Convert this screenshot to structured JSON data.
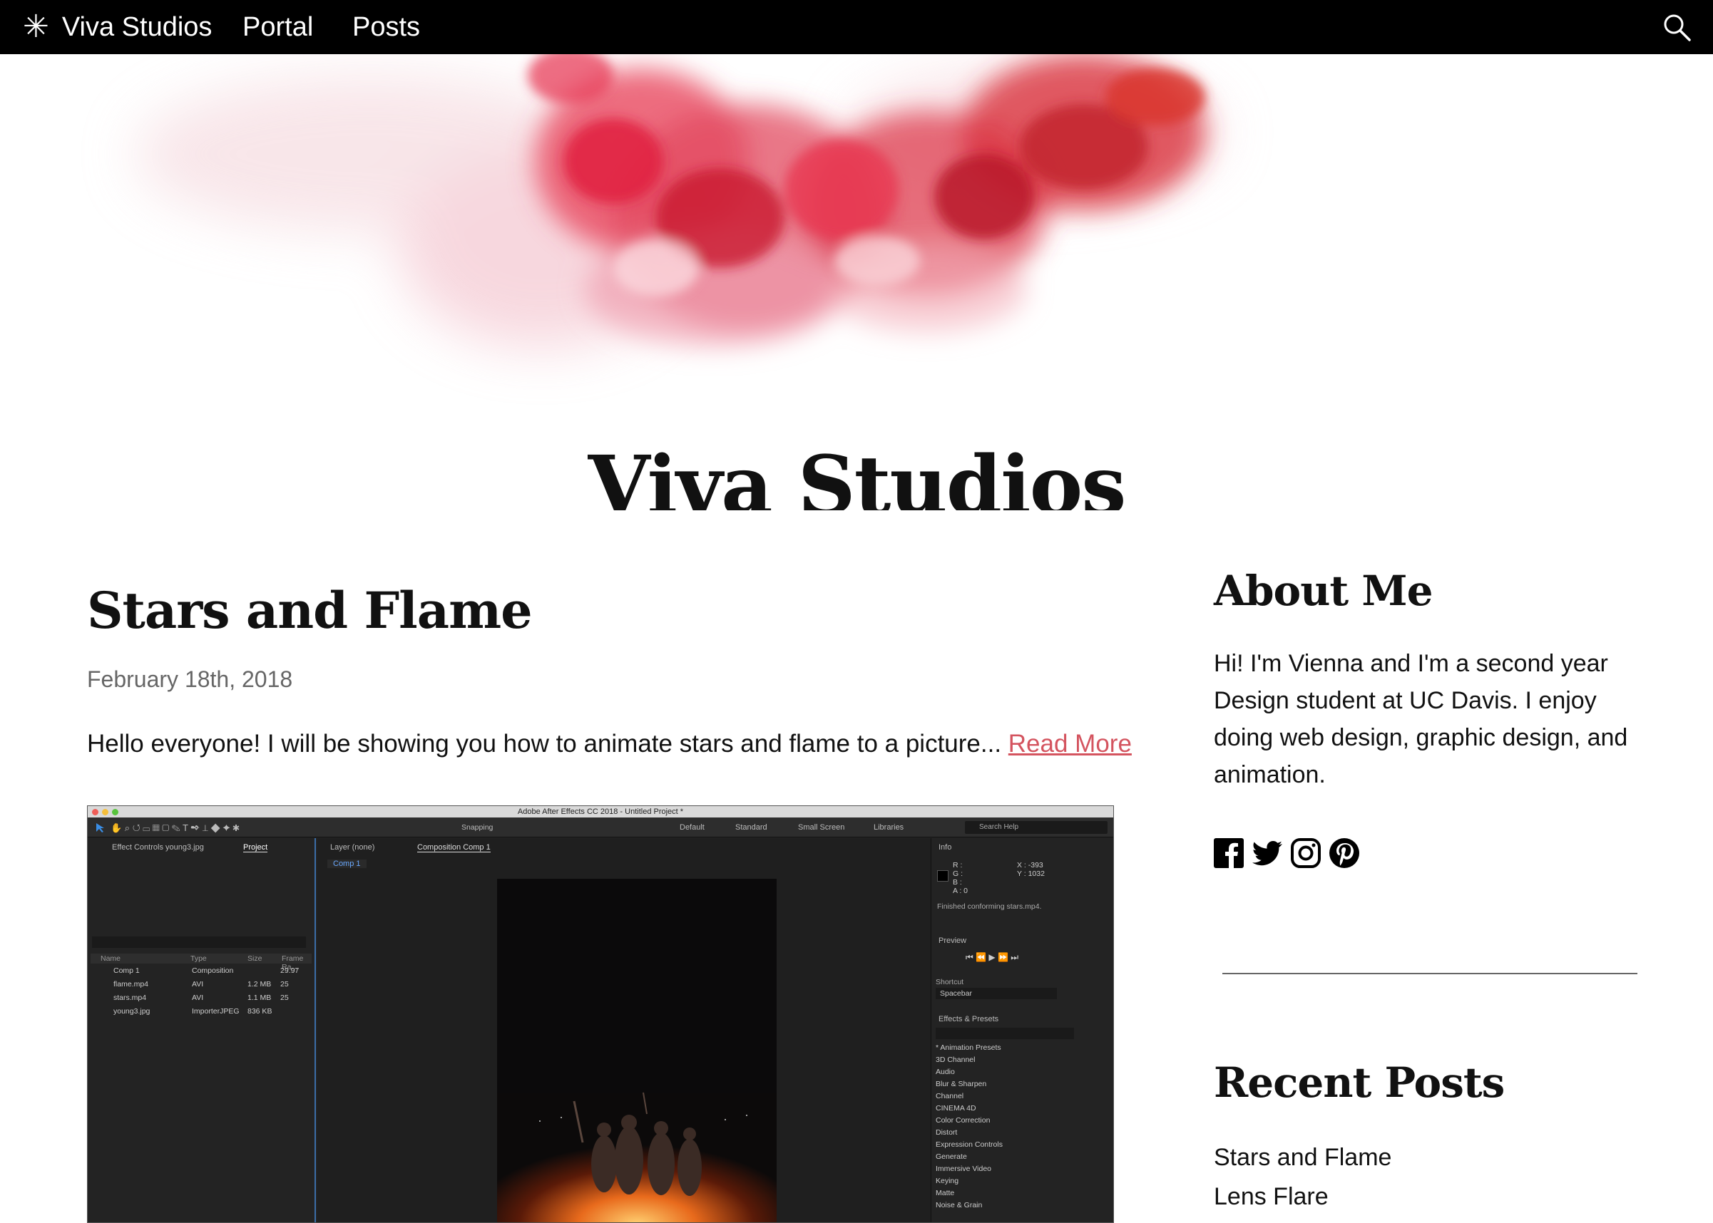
{
  "nav": {
    "brand": "Viva Studios",
    "links": [
      "Portal",
      "Posts"
    ]
  },
  "hero": {
    "title": "Viva Studios"
  },
  "post": {
    "title": "Stars and Flame",
    "date": "February 18th, 2018",
    "excerpt": "Hello everyone! I will be showing you how to animate stars and flame to a picture...",
    "read_more": "Read More"
  },
  "screenshot": {
    "window_title": "Adobe After Effects CC 2018 - Untitled Project *",
    "workspaces": [
      "Default",
      "Standard",
      "Small Screen",
      "Libraries"
    ],
    "snapping": "Snapping",
    "search_help": "Search Help",
    "left_tabs": [
      "Effect Controls young3.jpg",
      "Project"
    ],
    "project_headers": [
      "Name",
      "Type",
      "Size",
      "Frame Ra..."
    ],
    "project_rows": [
      {
        "name": "Comp 1",
        "type": "Composition",
        "size": "",
        "fps": "29.97"
      },
      {
        "name": "flame.mp4",
        "type": "AVI",
        "size": "1.2 MB",
        "fps": "25"
      },
      {
        "name": "stars.mp4",
        "type": "AVI",
        "size": "1.1 MB",
        "fps": "25"
      },
      {
        "name": "young3.jpg",
        "type": "ImporterJPEG",
        "size": "836 KB",
        "fps": ""
      }
    ],
    "layer_tab": "Layer (none)",
    "comp_tab": "Composition Comp 1",
    "comp_sub": "Comp 1",
    "info_title": "Info",
    "info_rgb": [
      "R :",
      "G :",
      "B :",
      "A : 0"
    ],
    "info_xy": [
      "X : -393",
      "Y : 1032"
    ],
    "info_status": "Finished conforming stars.mp4.",
    "preview_title": "Preview",
    "shortcut_label": "Shortcut",
    "shortcut_value": "Spacebar",
    "effects_title": "Effects & Presets",
    "effects": [
      "* Animation Presets",
      "3D Channel",
      "Audio",
      "Blur & Sharpen",
      "Channel",
      "CINEMA 4D",
      "Color Correction",
      "Distort",
      "Expression Controls",
      "Generate",
      "Immersive Video",
      "Keying",
      "Matte",
      "Noise & Grain"
    ]
  },
  "sidebar": {
    "about_title": "About Me",
    "about_text": "Hi! I'm Vienna and I'm a second year Design student at UC Davis. I enjoy doing web design, graphic design, and animation.",
    "social_icons": [
      "facebook-icon",
      "twitter-icon",
      "instagram-icon",
      "pinterest-icon"
    ],
    "recent_title": "Recent Posts",
    "recent_posts": [
      "Stars and Flame",
      "Lens Flare"
    ]
  },
  "colors": {
    "nav_bg": "#000000",
    "link_accent": "#d4545f",
    "smoke": "#e0203f"
  }
}
